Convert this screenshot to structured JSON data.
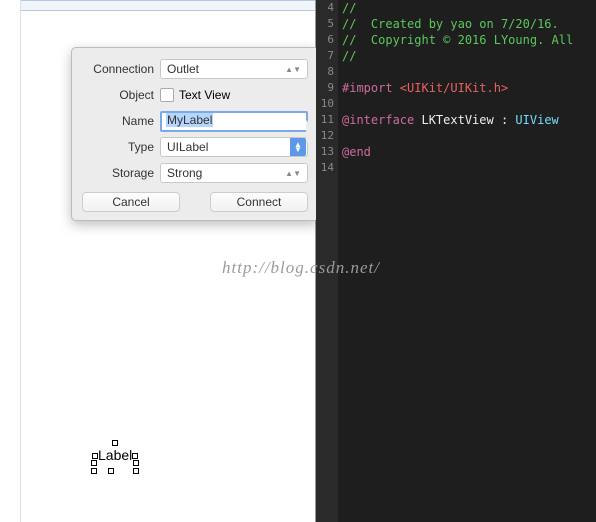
{
  "popover": {
    "labels": {
      "connection": "Connection",
      "object": "Object",
      "name": "Name",
      "type": "Type",
      "storage": "Storage"
    },
    "connection_value": "Outlet",
    "object_value": "Text View",
    "name_value": "MyLabel",
    "type_value": "UILabel",
    "storage_value": "Strong",
    "cancel": "Cancel",
    "connect": "Connect"
  },
  "canvas": {
    "label_text": "Label"
  },
  "editor": {
    "line_numbers": [
      "4",
      "5",
      "6",
      "7",
      "8",
      "9",
      "10",
      "11",
      "12",
      "13",
      "14"
    ],
    "lines": {
      "l4_a": "//",
      "l5_a": "//  Created by yao on 7/20/16.",
      "l6_a": "//  Copyright © 2016 LYoung. All",
      "l7_a": "//",
      "l9_a": "#import ",
      "l9_b": "<UIKit/UIKit.h>",
      "l11_a": "@interface ",
      "l11_b": "LKTextView",
      "l11_c": " : ",
      "l11_d": "UIView",
      "l13_a": "@end"
    }
  },
  "watermark": "http://blog.csdn.net/"
}
